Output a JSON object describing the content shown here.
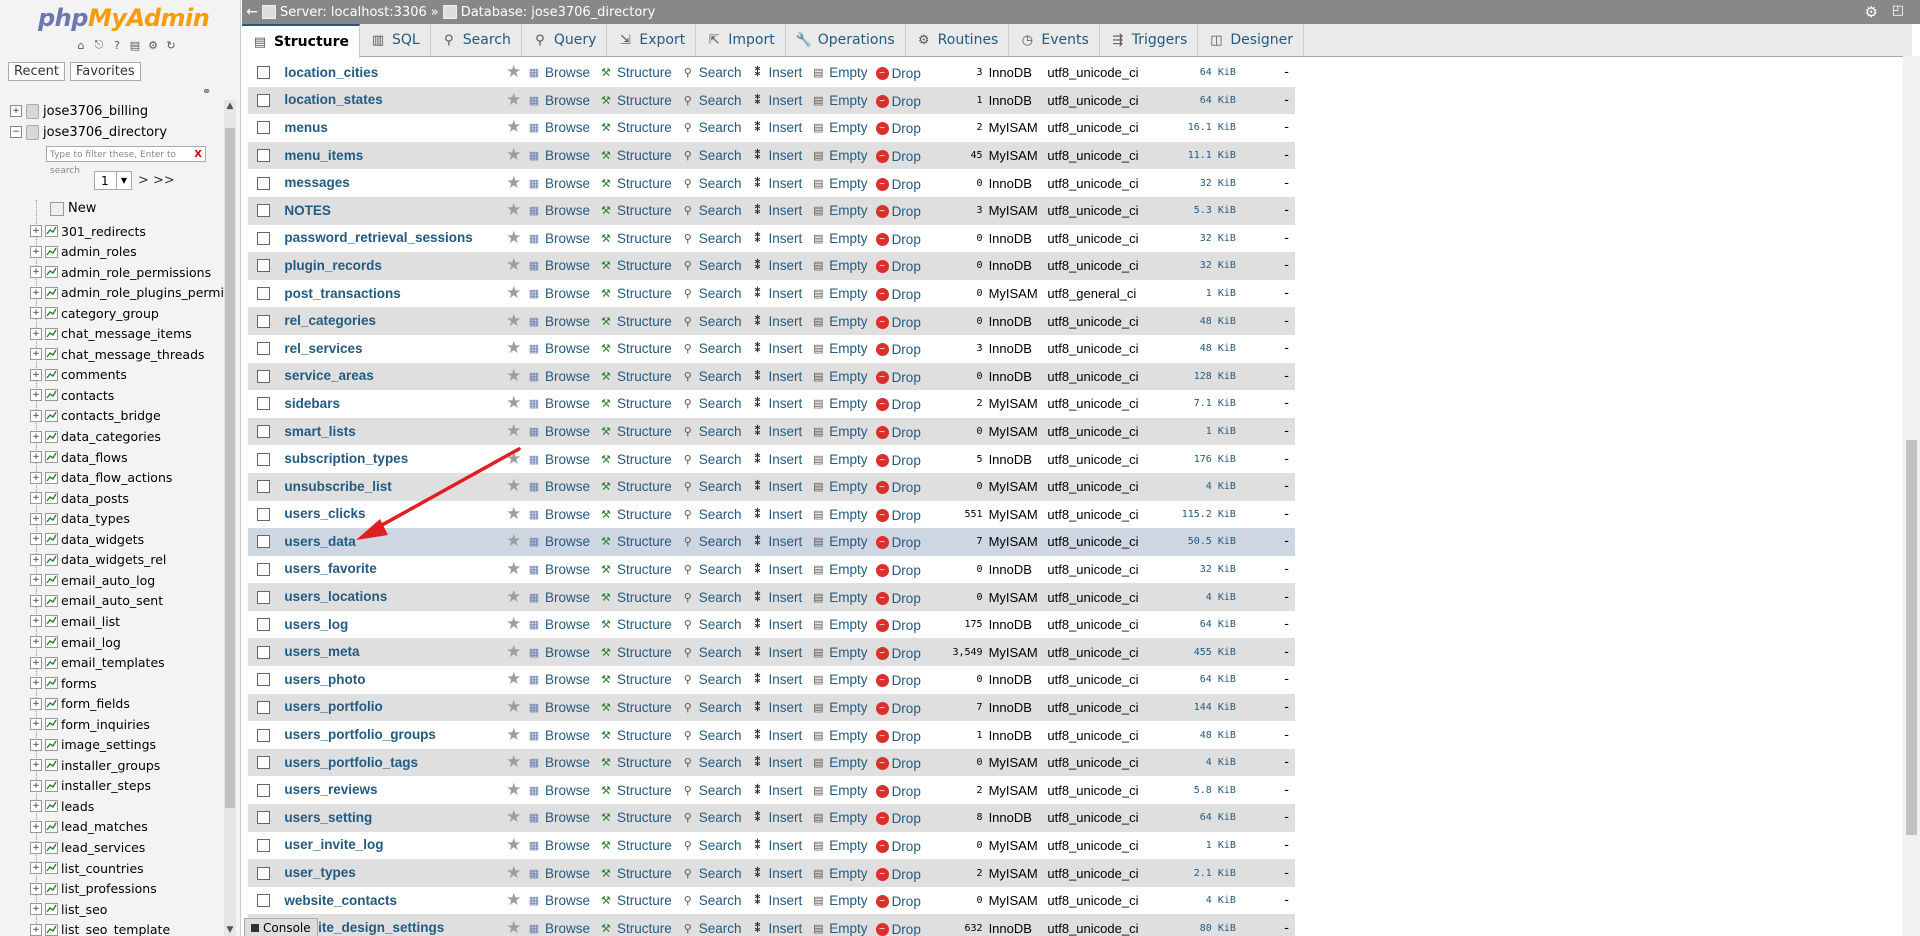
{
  "sidebar": {
    "logo_php": "php",
    "logo_rest": "MyAdmin",
    "tab_recent": "Recent",
    "tab_favorites": "Favorites",
    "db1": "jose3706_billing",
    "db2": "jose3706_directory",
    "filter_placeholder": "Type to filter these, Enter to search",
    "filter_clear": "X",
    "page_select": "1",
    "page_next": "> >>",
    "new_label": "New",
    "tables": [
      "301_redirects",
      "admin_roles",
      "admin_role_permissions",
      "admin_role_plugins_permis",
      "category_group",
      "chat_message_items",
      "chat_message_threads",
      "comments",
      "contacts",
      "contacts_bridge",
      "data_categories",
      "data_flows",
      "data_flow_actions",
      "data_posts",
      "data_types",
      "data_widgets",
      "data_widgets_rel",
      "email_auto_log",
      "email_auto_sent",
      "email_list",
      "email_log",
      "email_templates",
      "forms",
      "form_fields",
      "form_inquiries",
      "image_settings",
      "installer_groups",
      "installer_steps",
      "leads",
      "lead_matches",
      "lead_services",
      "list_countries",
      "list_professions",
      "list_seo",
      "list_seo_template"
    ]
  },
  "topbar": {
    "server": "Server: localhost:3306",
    "sep": "»",
    "database": "Database: jose3706_directory"
  },
  "tabs": [
    "Structure",
    "SQL",
    "Search",
    "Query",
    "Export",
    "Import",
    "Operations",
    "Routines",
    "Events",
    "Triggers",
    "Designer"
  ],
  "actions": {
    "browse": "Browse",
    "structure": "Structure",
    "search": "Search",
    "insert": "Insert",
    "empty": "Empty",
    "drop": "Drop"
  },
  "rows": [
    {
      "name": "location_cities",
      "rows": "3",
      "engine": "InnoDB",
      "collation": "utf8_unicode_ci",
      "size": "64",
      "unit": "KiB",
      "overhead": "-"
    },
    {
      "name": "location_states",
      "rows": "1",
      "engine": "InnoDB",
      "collation": "utf8_unicode_ci",
      "size": "64",
      "unit": "KiB",
      "overhead": "-"
    },
    {
      "name": "menus",
      "rows": "2",
      "engine": "MyISAM",
      "collation": "utf8_unicode_ci",
      "size": "16.1",
      "unit": "KiB",
      "overhead": "-"
    },
    {
      "name": "menu_items",
      "rows": "45",
      "engine": "MyISAM",
      "collation": "utf8_unicode_ci",
      "size": "11.1",
      "unit": "KiB",
      "overhead": "-"
    },
    {
      "name": "messages",
      "rows": "0",
      "engine": "InnoDB",
      "collation": "utf8_unicode_ci",
      "size": "32",
      "unit": "KiB",
      "overhead": "-"
    },
    {
      "name": "NOTES",
      "rows": "3",
      "engine": "MyISAM",
      "collation": "utf8_unicode_ci",
      "size": "5.3",
      "unit": "KiB",
      "overhead": "-"
    },
    {
      "name": "password_retrieval_sessions",
      "rows": "0",
      "engine": "InnoDB",
      "collation": "utf8_unicode_ci",
      "size": "32",
      "unit": "KiB",
      "overhead": "-"
    },
    {
      "name": "plugin_records",
      "rows": "0",
      "engine": "InnoDB",
      "collation": "utf8_unicode_ci",
      "size": "32",
      "unit": "KiB",
      "overhead": "-"
    },
    {
      "name": "post_transactions",
      "rows": "0",
      "engine": "MyISAM",
      "collation": "utf8_general_ci",
      "size": "1",
      "unit": "KiB",
      "overhead": "-"
    },
    {
      "name": "rel_categories",
      "rows": "0",
      "engine": "InnoDB",
      "collation": "utf8_unicode_ci",
      "size": "48",
      "unit": "KiB",
      "overhead": "-"
    },
    {
      "name": "rel_services",
      "rows": "3",
      "engine": "InnoDB",
      "collation": "utf8_unicode_ci",
      "size": "48",
      "unit": "KiB",
      "overhead": "-"
    },
    {
      "name": "service_areas",
      "rows": "0",
      "engine": "InnoDB",
      "collation": "utf8_unicode_ci",
      "size": "128",
      "unit": "KiB",
      "overhead": "-"
    },
    {
      "name": "sidebars",
      "rows": "2",
      "engine": "MyISAM",
      "collation": "utf8_unicode_ci",
      "size": "7.1",
      "unit": "KiB",
      "overhead": "-"
    },
    {
      "name": "smart_lists",
      "rows": "0",
      "engine": "MyISAM",
      "collation": "utf8_unicode_ci",
      "size": "1",
      "unit": "KiB",
      "overhead": "-"
    },
    {
      "name": "subscription_types",
      "rows": "5",
      "engine": "InnoDB",
      "collation": "utf8_unicode_ci",
      "size": "176",
      "unit": "KiB",
      "overhead": "-"
    },
    {
      "name": "unsubscribe_list",
      "rows": "0",
      "engine": "MyISAM",
      "collation": "utf8_unicode_ci",
      "size": "4",
      "unit": "KiB",
      "overhead": "-"
    },
    {
      "name": "users_clicks",
      "rows": "551",
      "engine": "MyISAM",
      "collation": "utf8_unicode_ci",
      "size": "115.2",
      "unit": "KiB",
      "overhead": "-"
    },
    {
      "name": "users_data",
      "rows": "7",
      "engine": "MyISAM",
      "collation": "utf8_unicode_ci",
      "size": "50.5",
      "unit": "KiB",
      "overhead": "-"
    },
    {
      "name": "users_favorite",
      "rows": "0",
      "engine": "InnoDB",
      "collation": "utf8_unicode_ci",
      "size": "32",
      "unit": "KiB",
      "overhead": "-"
    },
    {
      "name": "users_locations",
      "rows": "0",
      "engine": "MyISAM",
      "collation": "utf8_unicode_ci",
      "size": "4",
      "unit": "KiB",
      "overhead": "-"
    },
    {
      "name": "users_log",
      "rows": "175",
      "engine": "InnoDB",
      "collation": "utf8_unicode_ci",
      "size": "64",
      "unit": "KiB",
      "overhead": "-"
    },
    {
      "name": "users_meta",
      "rows": "3,549",
      "engine": "MyISAM",
      "collation": "utf8_unicode_ci",
      "size": "455",
      "unit": "KiB",
      "overhead": "-"
    },
    {
      "name": "users_photo",
      "rows": "0",
      "engine": "InnoDB",
      "collation": "utf8_unicode_ci",
      "size": "64",
      "unit": "KiB",
      "overhead": "-"
    },
    {
      "name": "users_portfolio",
      "rows": "7",
      "engine": "InnoDB",
      "collation": "utf8_unicode_ci",
      "size": "144",
      "unit": "KiB",
      "overhead": "-"
    },
    {
      "name": "users_portfolio_groups",
      "rows": "1",
      "engine": "InnoDB",
      "collation": "utf8_unicode_ci",
      "size": "48",
      "unit": "KiB",
      "overhead": "-"
    },
    {
      "name": "users_portfolio_tags",
      "rows": "0",
      "engine": "MyISAM",
      "collation": "utf8_unicode_ci",
      "size": "4",
      "unit": "KiB",
      "overhead": "-"
    },
    {
      "name": "users_reviews",
      "rows": "2",
      "engine": "MyISAM",
      "collation": "utf8_unicode_ci",
      "size": "5.8",
      "unit": "KiB",
      "overhead": "-"
    },
    {
      "name": "users_setting",
      "rows": "8",
      "engine": "InnoDB",
      "collation": "utf8_unicode_ci",
      "size": "64",
      "unit": "KiB",
      "overhead": "-"
    },
    {
      "name": "user_invite_log",
      "rows": "0",
      "engine": "MyISAM",
      "collation": "utf8_unicode_ci",
      "size": "1",
      "unit": "KiB",
      "overhead": "-"
    },
    {
      "name": "user_types",
      "rows": "2",
      "engine": "MyISAM",
      "collation": "utf8_unicode_ci",
      "size": "2.1",
      "unit": "KiB",
      "overhead": "-"
    },
    {
      "name": "website_contacts",
      "rows": "0",
      "engine": "MyISAM",
      "collation": "utf8_unicode_ci",
      "size": "4",
      "unit": "KiB",
      "overhead": "-"
    },
    {
      "name": "website_design_settings",
      "rows": "632",
      "engine": "InnoDB",
      "collation": "utf8_unicode_ci",
      "size": "80",
      "unit": "KiB",
      "overhead": "-"
    }
  ],
  "highlighted_row": "users_data",
  "console_label": "Console",
  "colors": {
    "link": "#235a81",
    "arrow": "#e02020",
    "highlight": "#ced6e2"
  }
}
